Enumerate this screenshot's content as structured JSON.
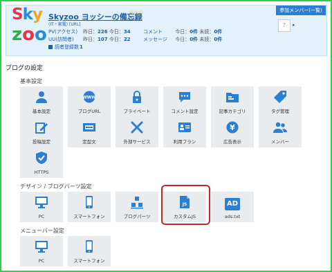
{
  "header": {
    "logo_line1": "Sky",
    "logo_line2": "zoo",
    "blog_title": "Skyzoo ヨッシーの備忘録",
    "stars": "☆☆☆",
    "category": "(IT・家電)",
    "url_link": "[URL]",
    "stats": {
      "pv_label": "PV(アクセス)",
      "uu_label": "UU(訪問者)",
      "subs_label": "読者登録数",
      "today": "昨日：",
      "today2": "今日：",
      "pv_yesterday": "226",
      "pv_today": "34",
      "uu_yesterday": "107",
      "uu_today": "22",
      "subscribers": "1"
    },
    "comment_label": "コメント",
    "message_label": "メッセージ",
    "today_label": "今日：",
    "unread_label": "未読：",
    "comment_today": "0件",
    "comment_unread": "0件",
    "message_today": "0件",
    "message_unread": "0件",
    "member_button": "参加メンバー(一覧)",
    "member_placeholder": "? ",
    "member_arrow": "▸"
  },
  "page": {
    "section_title": "ブログの設定"
  },
  "groups": {
    "basic": "基本設定",
    "design": "デザイン / ブログパーツ設定",
    "menubar": "メニューバー設定"
  },
  "tiles": {
    "basic": [
      {
        "label": "基本設定",
        "icon": "person-icon"
      },
      {
        "label": "ブログURL",
        "icon": "www-icon"
      },
      {
        "label": "プライベート",
        "icon": "lock-icon"
      },
      {
        "label": "コメント設定",
        "icon": "speech-bubble-icon"
      },
      {
        "label": "記事カテゴリ",
        "icon": "folder-icon"
      },
      {
        "label": "タグ管理",
        "icon": "tag-icon"
      },
      {
        "label": "投稿設定",
        "icon": "pencil-note-icon"
      },
      {
        "label": "定型文",
        "icon": "template-icon"
      },
      {
        "label": "外部サービス",
        "icon": "tools-icon"
      },
      {
        "label": "利用プラン",
        "icon": "card-icon"
      },
      {
        "label": "広告表示",
        "icon": "yen-icon"
      },
      {
        "label": "メンバー",
        "icon": "members-icon"
      },
      {
        "label": "HTTPS",
        "icon": "shield-check-icon"
      }
    ],
    "design": [
      {
        "label": "PC",
        "icon": "monitor-icon"
      },
      {
        "label": "スマートフォン",
        "icon": "smartphone-icon"
      },
      {
        "label": "ブログパーツ",
        "icon": "blocks-icon"
      },
      {
        "label": "カスタムJS",
        "icon": "js-file-icon"
      },
      {
        "label": "ads.txt",
        "icon": "ad-icon",
        "badge": "AD"
      }
    ],
    "menubar": [
      {
        "label": "PC",
        "icon": "monitor-icon"
      },
      {
        "label": "スマートフォン",
        "icon": "smartphone-icon"
      }
    ]
  },
  "colors": {
    "accent": "#2a7fd4",
    "highlight": "#c0252d",
    "frame": "#2ecf45",
    "header_bg": "#e3f1fb",
    "tile_bg": "#e9ecef"
  }
}
